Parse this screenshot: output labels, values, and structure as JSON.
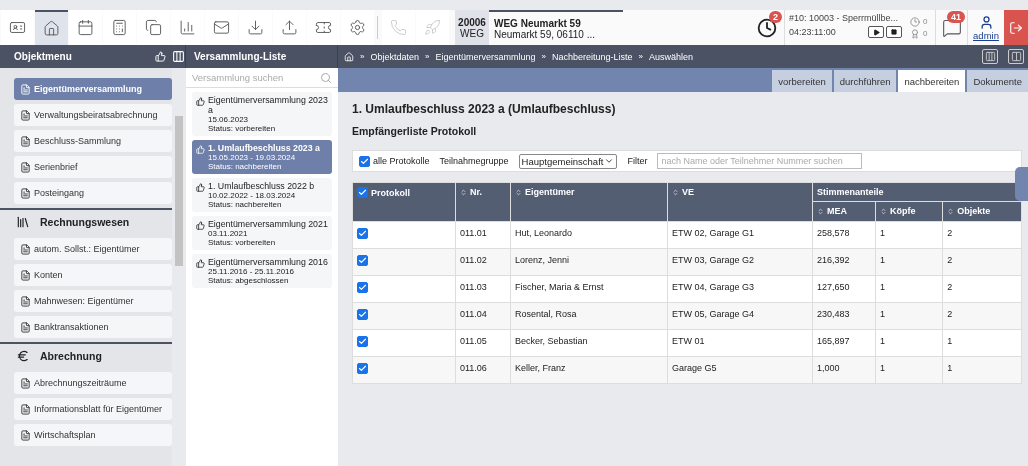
{
  "toolbar": {
    "icons": [
      {
        "kind": "card",
        "selected": false,
        "disabled": false
      },
      {
        "kind": "home",
        "selected": true,
        "disabled": false
      },
      {
        "kind": "calendar",
        "selected": false,
        "disabled": false
      },
      {
        "kind": "calculator",
        "selected": false,
        "disabled": false
      },
      {
        "kind": "copy",
        "selected": false,
        "disabled": false
      },
      {
        "kind": "chart",
        "selected": false,
        "disabled": false
      },
      {
        "kind": "mail",
        "selected": false,
        "disabled": false
      },
      {
        "kind": "download",
        "selected": false,
        "disabled": false
      },
      {
        "kind": "upload",
        "selected": false,
        "disabled": false
      },
      {
        "kind": "coupon",
        "selected": false,
        "disabled": false
      },
      {
        "kind": "gear",
        "selected": false,
        "disabled": false
      },
      {
        "kind": "phone",
        "selected": false,
        "disabled": true
      },
      {
        "kind": "rocket",
        "selected": false,
        "disabled": true
      }
    ]
  },
  "object": {
    "number": "20006",
    "type": "WEG",
    "name": "WEG Neumarkt 59",
    "address": "Neumarkt 59, 06110 ..."
  },
  "timer": {
    "badge": "2",
    "task": "#10: 10003 - Sperrmüllbe...",
    "time": "04:23:11:00"
  },
  "counters": [
    "0",
    "0"
  ],
  "messages": {
    "badge": "41"
  },
  "user": {
    "name": "admin"
  },
  "object_menu": {
    "title": "Objektmenu"
  },
  "list_panel": {
    "title": "Versammlung-Liste",
    "search_placeholder": "Versammlung suchen"
  },
  "breadcrumb": {
    "separator": "»",
    "items": [
      "Objektdaten",
      "Eigentümerversammlung",
      "Nachbereitung-Liste",
      "Auswählen"
    ]
  },
  "sidebar": {
    "items": [
      {
        "kind": "item",
        "label": "Eigentümerversammlung",
        "selected": true
      },
      {
        "kind": "item",
        "label": "Verwaltungsbeiratsabrechnung",
        "selected": false
      },
      {
        "kind": "item",
        "label": "Beschluss-Sammlung",
        "selected": false
      },
      {
        "kind": "item",
        "label": "Serienbrief",
        "selected": false
      },
      {
        "kind": "item",
        "label": "Posteingang",
        "selected": false
      },
      {
        "kind": "section",
        "label": "Rechnungswesen"
      },
      {
        "kind": "item",
        "label": "autom. Sollst.: Eigentümer",
        "selected": false
      },
      {
        "kind": "item",
        "label": "Konten",
        "selected": false
      },
      {
        "kind": "item",
        "label": "Mahnwesen: Eigentümer",
        "selected": false
      },
      {
        "kind": "item",
        "label": "Banktransaktionen",
        "selected": false
      },
      {
        "kind": "section",
        "label": "Abrechnung"
      },
      {
        "kind": "item",
        "label": "Abrechnungszeiträume",
        "selected": false
      },
      {
        "kind": "item",
        "label": "Informationsblatt für Eigentümer",
        "selected": false
      },
      {
        "kind": "item",
        "label": "Wirtschaftsplan",
        "selected": false
      }
    ]
  },
  "meetings": [
    {
      "title": "Eigentümerversammlung 2023 a",
      "dates": "15.06.2023",
      "status": "Status: vorbereiten",
      "selected": false
    },
    {
      "title": "1. Umlaufbeschluss 2023 a",
      "dates": "15.05.2023 - 19.03.2024",
      "status": "Status: nachbereiten",
      "selected": true
    },
    {
      "title": "1. Umlaufbeschluss 2022 b",
      "dates": "10.02.2022 - 18.03.2024",
      "status": "Status: nachbereiten",
      "selected": false
    },
    {
      "title": "Eigentümerversammlung 2021",
      "dates": "03.11.2021",
      "status": "Status: vorbereiten",
      "selected": false
    },
    {
      "title": "Eigentümerversammlung 2016",
      "dates": "25.11.2016 - 25.11.2016",
      "status": "Status: abgeschlossen",
      "selected": false
    }
  ],
  "tabs": [
    {
      "label": "vorbereiten",
      "selected": false
    },
    {
      "label": "durchführen",
      "selected": false
    },
    {
      "label": "nachbereiten",
      "selected": true
    },
    {
      "label": "Dokumente",
      "selected": false
    }
  ],
  "heading": "1. Umlaufbeschluss 2023 a (Umlaufbeschluss)",
  "subheading": "Empfängerliste Protokoll",
  "filter_bar": {
    "all_label": "alle Protokolle",
    "all_checked": true,
    "group_label": "Teilnahmegruppe",
    "group_value": "Hauptgemeinschaft",
    "filter_label": "Filter",
    "filter_placeholder": "nach Name oder Teilnehmer Nummer suchen"
  },
  "table": {
    "header_checked": true,
    "columns": [
      "Protokoll",
      "Nr.",
      "Eigentümer",
      "VE"
    ],
    "group": "Stimmenanteile",
    "sub_columns": [
      "MEA",
      "Köpfe",
      "Objekte"
    ],
    "rows": [
      {
        "checked": true,
        "cells": [
          "",
          "011.01",
          "Hut, Leonardo",
          "ETW 02, Garage G1",
          "258,578",
          "1",
          "2"
        ]
      },
      {
        "checked": true,
        "cells": [
          "",
          "011.02",
          "Lorenz, Jenni",
          "ETW 03, Garage G2",
          "216,392",
          "1",
          "2"
        ]
      },
      {
        "checked": true,
        "cells": [
          "",
          "011.03",
          "Fischer, Maria & Ernst",
          "ETW 04, Garage G3",
          "127,650",
          "1",
          "2"
        ]
      },
      {
        "checked": true,
        "cells": [
          "",
          "011.04",
          "Rosental, Rosa",
          "ETW 05, Garage G4",
          "230,483",
          "1",
          "2"
        ]
      },
      {
        "checked": true,
        "cells": [
          "",
          "011.05",
          "Becker, Sebastian",
          "ETW 01",
          "165,897",
          "1",
          "1"
        ]
      },
      {
        "checked": true,
        "cells": [
          "",
          "011.06",
          "Keller, Franz",
          "Garage G5",
          "1,000",
          "1",
          "1"
        ]
      }
    ]
  }
}
